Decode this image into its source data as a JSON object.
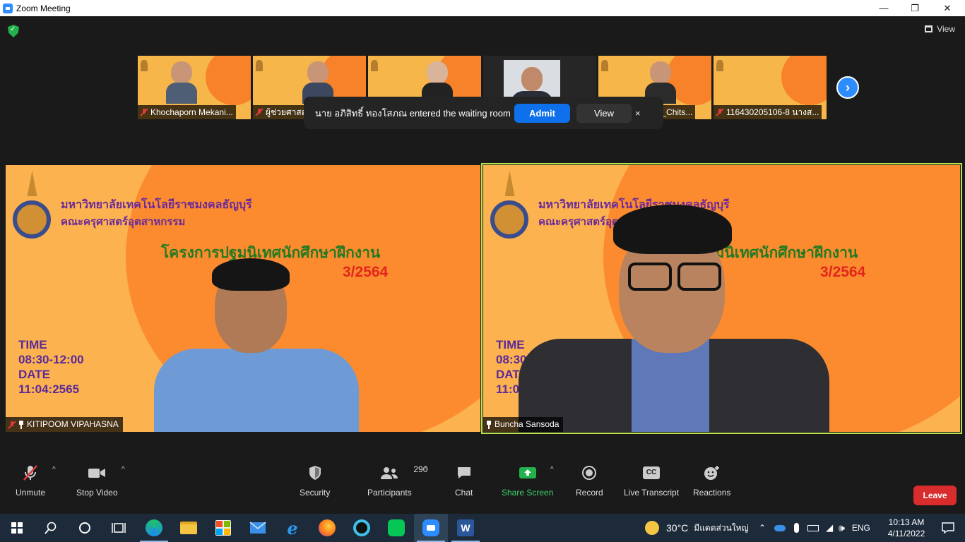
{
  "window": {
    "title": "Zoom Meeting"
  },
  "header": {
    "view_label": "View"
  },
  "thumbnails": [
    {
      "name": "Khochaporn Mekani...",
      "muted": true,
      "kind": "slide"
    },
    {
      "name": "ผู้ช่วยศาสตร",
      "muted": true,
      "kind": "slide"
    },
    {
      "name": "",
      "muted": false,
      "kind": "slide"
    },
    {
      "name": "",
      "muted": false,
      "kind": "photo"
    },
    {
      "name": "TechEd RMUTT_Chits...",
      "muted": false,
      "kind": "slide"
    },
    {
      "name": "116430205106-8 นางส...",
      "muted": true,
      "kind": "slide"
    }
  ],
  "waiting_room": {
    "message": "นาย อภิสิทธิ์ ทองโสภณ entered the waiting room",
    "admit_label": "Admit",
    "view_label": "View",
    "close_label": "×"
  },
  "slide": {
    "university": "มหาวิทยาลัยเทคโนโลยีราชมงคลธัญบุรี",
    "faculty": "คณะครุศาสตร์อุตสาหกรรม",
    "project": "โครงการปฐมนิเทศนักศึกษาฝึกงาน",
    "term": "3/2564",
    "time_label": "TIME",
    "time_value": "08:30-12:00",
    "date_label": "DATE",
    "date_value": "11:04:2565"
  },
  "tiles": {
    "left_name": "KITIPOOM VIPAHASNA",
    "right_name": "Buncha Sansoda"
  },
  "toolbar": {
    "unmute": "Unmute",
    "stop_video": "Stop Video",
    "security": "Security",
    "participants": "Participants",
    "participants_count": "290",
    "chat": "Chat",
    "share_screen": "Share Screen",
    "record": "Record",
    "live_transcript": "Live Transcript",
    "cc": "CC",
    "reactions": "Reactions",
    "leave": "Leave"
  },
  "taskbar": {
    "weather_temp": "30°C",
    "weather_text": "มีแดดส่วนใหญ่",
    "language": "ENG",
    "time": "10:13 AM",
    "date": "4/11/2022"
  },
  "colors": {
    "accent": "#2d8cff",
    "admit": "#0e71eb",
    "leave": "#d92d2d",
    "share": "#22b14c",
    "active_speaker": "#b9e34a"
  }
}
